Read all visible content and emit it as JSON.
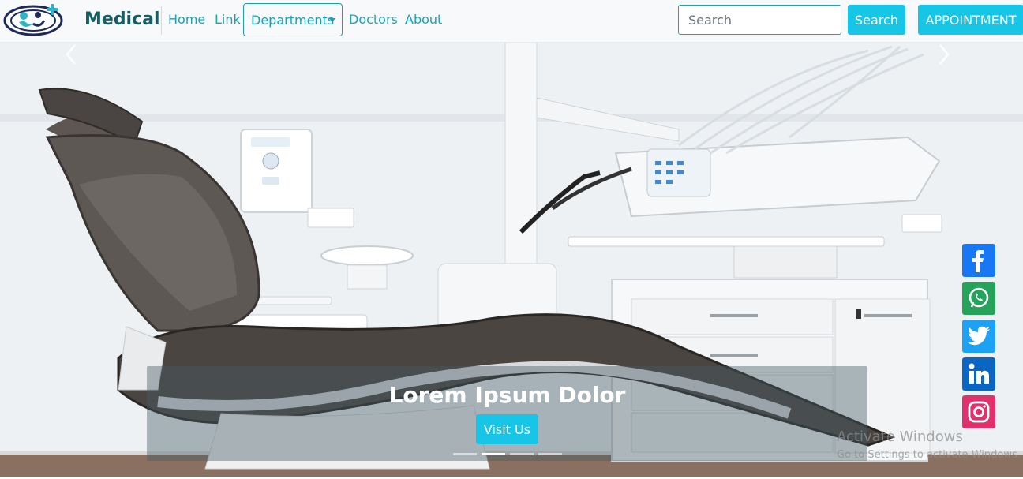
{
  "brand": {
    "name": "Medical"
  },
  "nav": {
    "links": [
      "Home",
      "Link",
      "Departments",
      "Doctors",
      "About"
    ]
  },
  "search": {
    "placeholder": "Search",
    "button_label": "Search"
  },
  "appointment": {
    "label": "APPOINTMENT"
  },
  "carousel": {
    "caption_title": "Lorem Ipsum Dolor",
    "button_label": "Visit Us",
    "slide_count": 4,
    "active_slide": 2
  },
  "social": [
    "facebook-icon",
    "whatsapp-icon",
    "twitter-icon",
    "linkedin-icon",
    "instagram-icon"
  ],
  "watermark": {
    "line1": "Activate Windows",
    "line2": "Go to Settings to activate Windows."
  },
  "colors": {
    "accent": "#17a2b8",
    "button": "#17c5e6",
    "brand": "#155e63",
    "facebook": "#1877f2",
    "whatsapp": "#25a35a",
    "twitter": "#1da1f2",
    "linkedin": "#0a66c2",
    "instagram": "#e1306c"
  }
}
